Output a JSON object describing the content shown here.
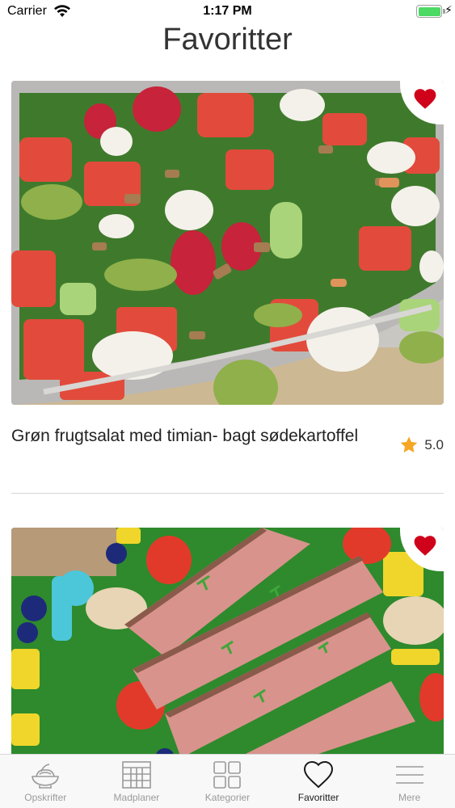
{
  "status_bar": {
    "carrier": "Carrier",
    "time": "1:17 PM"
  },
  "page": {
    "title": "Favoritter"
  },
  "recipes": [
    {
      "title": "Grøn frugtsalat med timian- bagt sødekartoffel",
      "rating": "5.0",
      "favorite": true
    },
    {
      "title": "",
      "favorite": true
    }
  ],
  "tab_bar": {
    "items": [
      {
        "label": "Opskrifter",
        "icon": "salad-bowl-icon"
      },
      {
        "label": "Madplaner",
        "icon": "calendar-grid-icon"
      },
      {
        "label": "Kategorier",
        "icon": "grid-squares-icon"
      },
      {
        "label": "Favoritter",
        "icon": "heart-outline-icon",
        "active": true
      },
      {
        "label": "Mere",
        "icon": "menu-lines-icon"
      }
    ]
  },
  "colors": {
    "heart": "#d0021b",
    "star": "#f5a623",
    "active_tab": "#1a1a1a",
    "inactive_tab": "#9a9a9a"
  }
}
